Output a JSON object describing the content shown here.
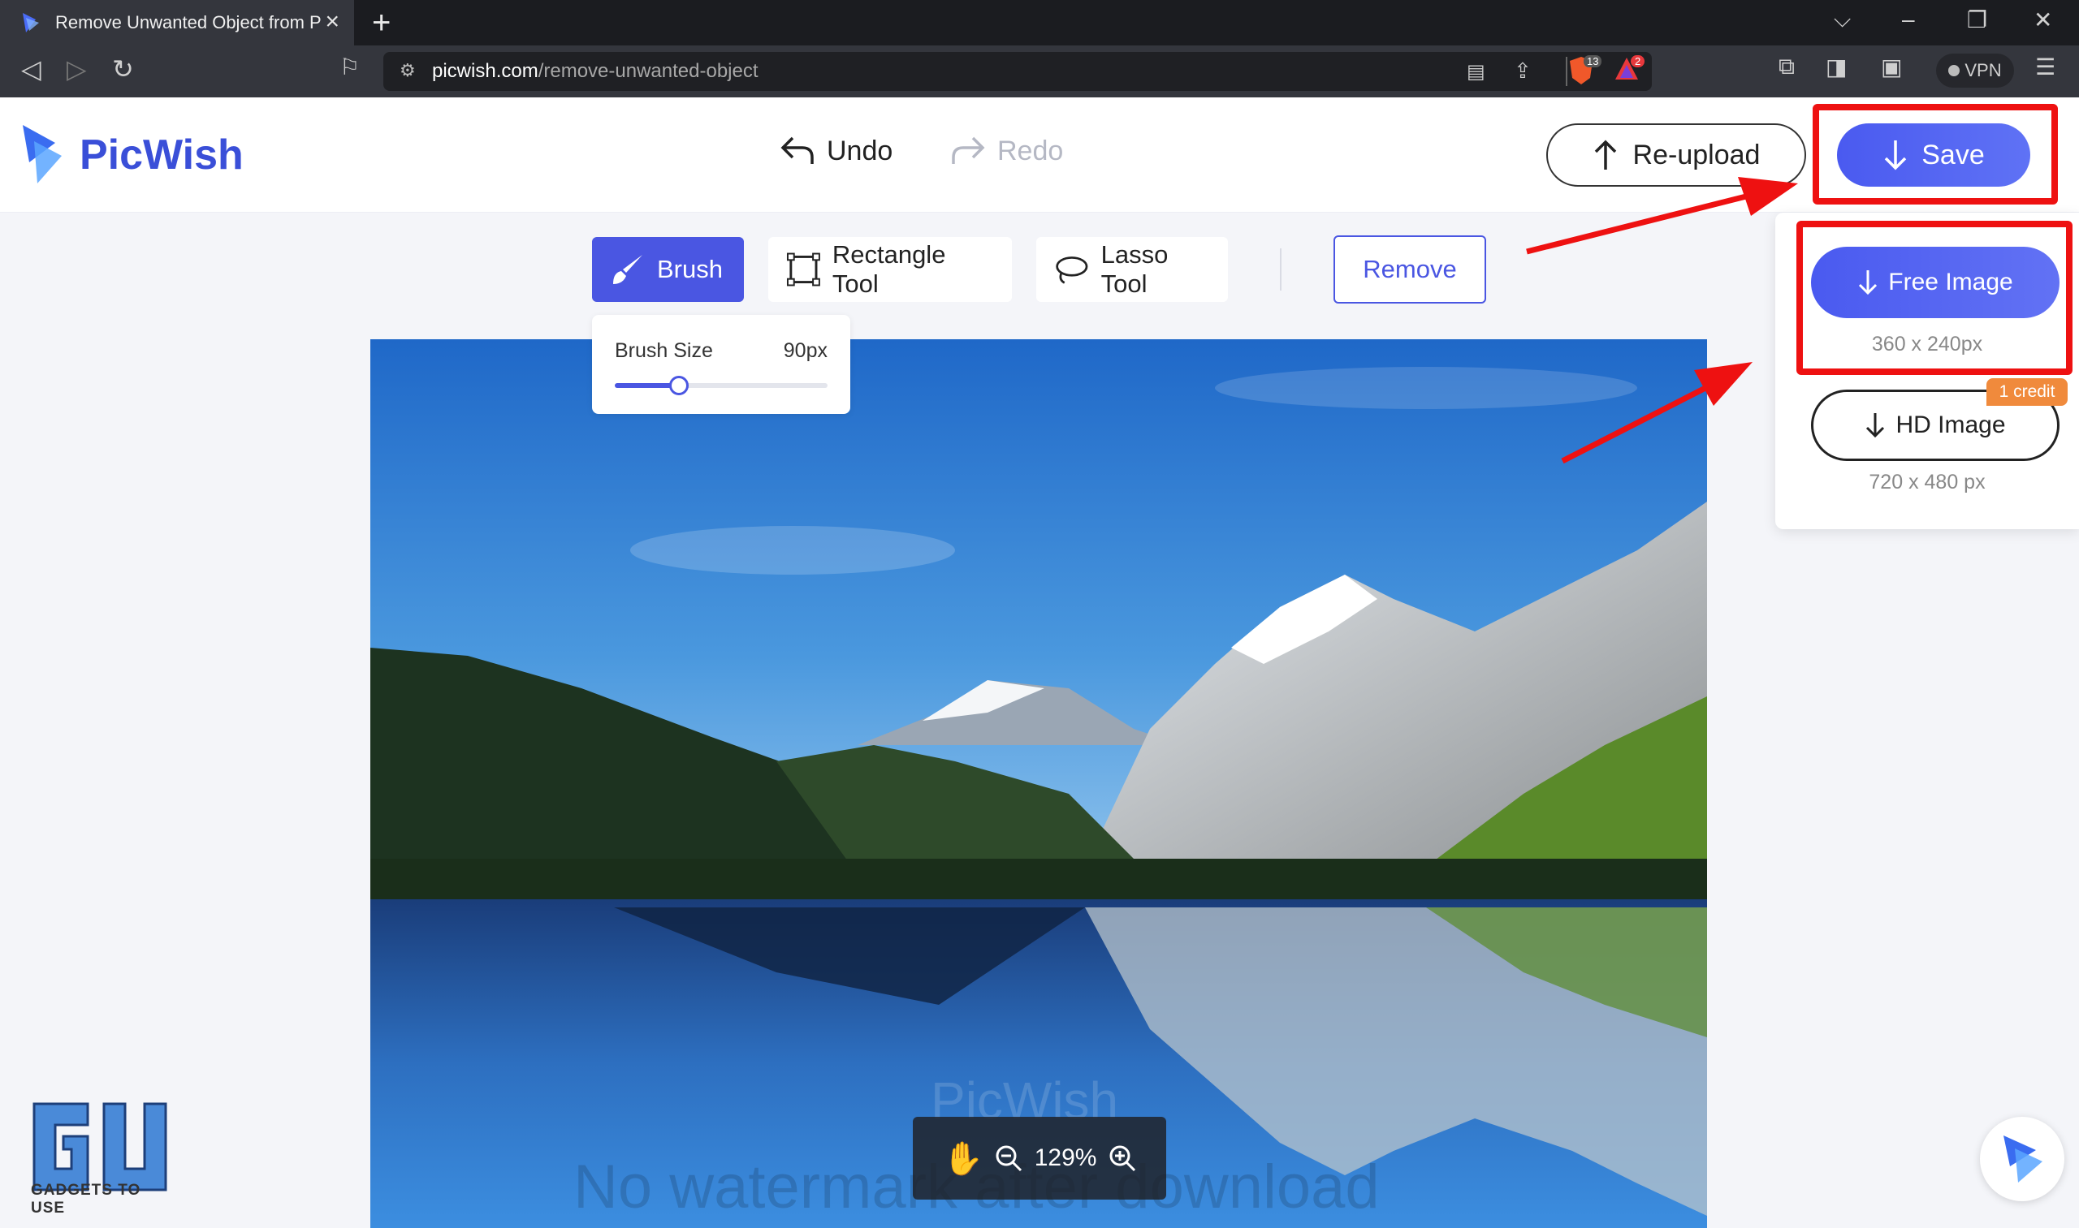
{
  "browser": {
    "tab_title": "Remove Unwanted Object from P",
    "url_domain": "picwish.com",
    "url_path": "/remove-unwanted-object",
    "vpn_label": "VPN",
    "shield_count": "13",
    "alert_count": "2"
  },
  "app": {
    "brand": "PicWish",
    "undo_label": "Undo",
    "redo_label": "Redo",
    "reupload_label": "Re-upload",
    "save_label": "Save"
  },
  "tools": {
    "brush": "Brush",
    "rectangle": "Rectangle Tool",
    "lasso": "Lasso Tool",
    "remove": "Remove",
    "brush_size_label": "Brush Size",
    "brush_size_value": "90px",
    "brush_size_fraction": 0.3
  },
  "canvas": {
    "watermark_brand": "PicWish",
    "watermark_note": "No watermark after download",
    "zoom": "129%"
  },
  "save_menu": {
    "free_label": "Free Image",
    "free_size": "360 x 240px",
    "hd_label": "HD Image",
    "hd_size": "720 x 480 px",
    "credit_badge": "1 credit"
  },
  "branding": {
    "gu_caption": "GADGETS TO USE"
  },
  "colors": {
    "accent": "#4a56e2",
    "annotation": "#ee1111",
    "badge": "#f08a3c"
  }
}
